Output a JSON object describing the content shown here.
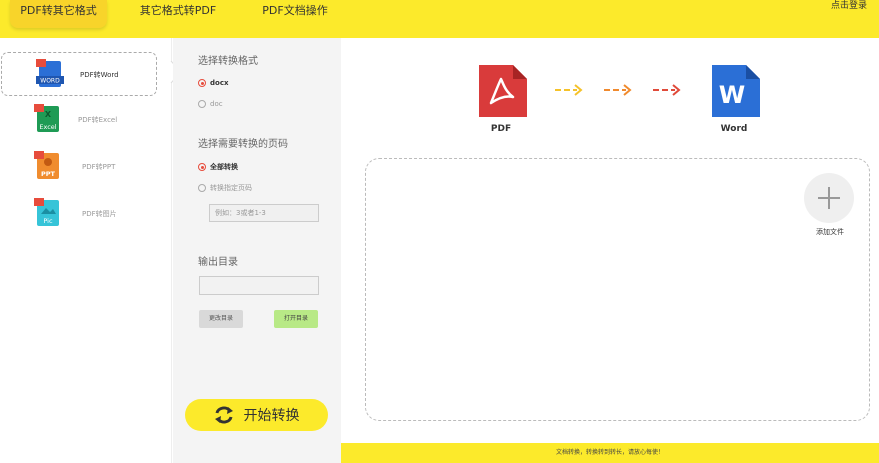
{
  "topbar": {
    "tabs": [
      "PDF转其它格式",
      "其它格式转PDF",
      "PDF文档操作"
    ],
    "login": "点击登录"
  },
  "nav": {
    "items": [
      {
        "label": "PDF转Word",
        "icon_text": "WORD",
        "color": "#2b6fd6",
        "icon": "word-file-icon"
      },
      {
        "label": "PDF转Excel",
        "icon_text": "Excel",
        "color": "#1f9b55",
        "icon": "excel-file-icon"
      },
      {
        "label": "PDF转PPT",
        "icon_text": "PPT",
        "color": "#f08c2e",
        "icon": "ppt-file-icon"
      },
      {
        "label": "PDF转图片",
        "icon_text": "Pic",
        "color": "#36c4d8",
        "icon": "image-file-icon"
      }
    ]
  },
  "options": {
    "format_title": "选择转换格式",
    "formats": [
      "docx",
      "doc"
    ],
    "pages_title": "选择需要转换的页码",
    "page_modes": [
      "全部转换",
      "转换指定页码"
    ],
    "page_placeholder": "例如：3或者1-3",
    "output_title": "输出目录",
    "change_dir": "更改目录",
    "open_dir": "打开目录",
    "start": "开始转换"
  },
  "main": {
    "from_label": "PDF",
    "to_label": "Word",
    "add_file": "添加文件"
  },
  "footer": "文档转换，转换转到转长，请放心每使！",
  "colors": {
    "accent": "#fcea2b",
    "pdf": "#d93b3b",
    "word": "#2b6fd6",
    "panel": "#f4f4f4"
  }
}
